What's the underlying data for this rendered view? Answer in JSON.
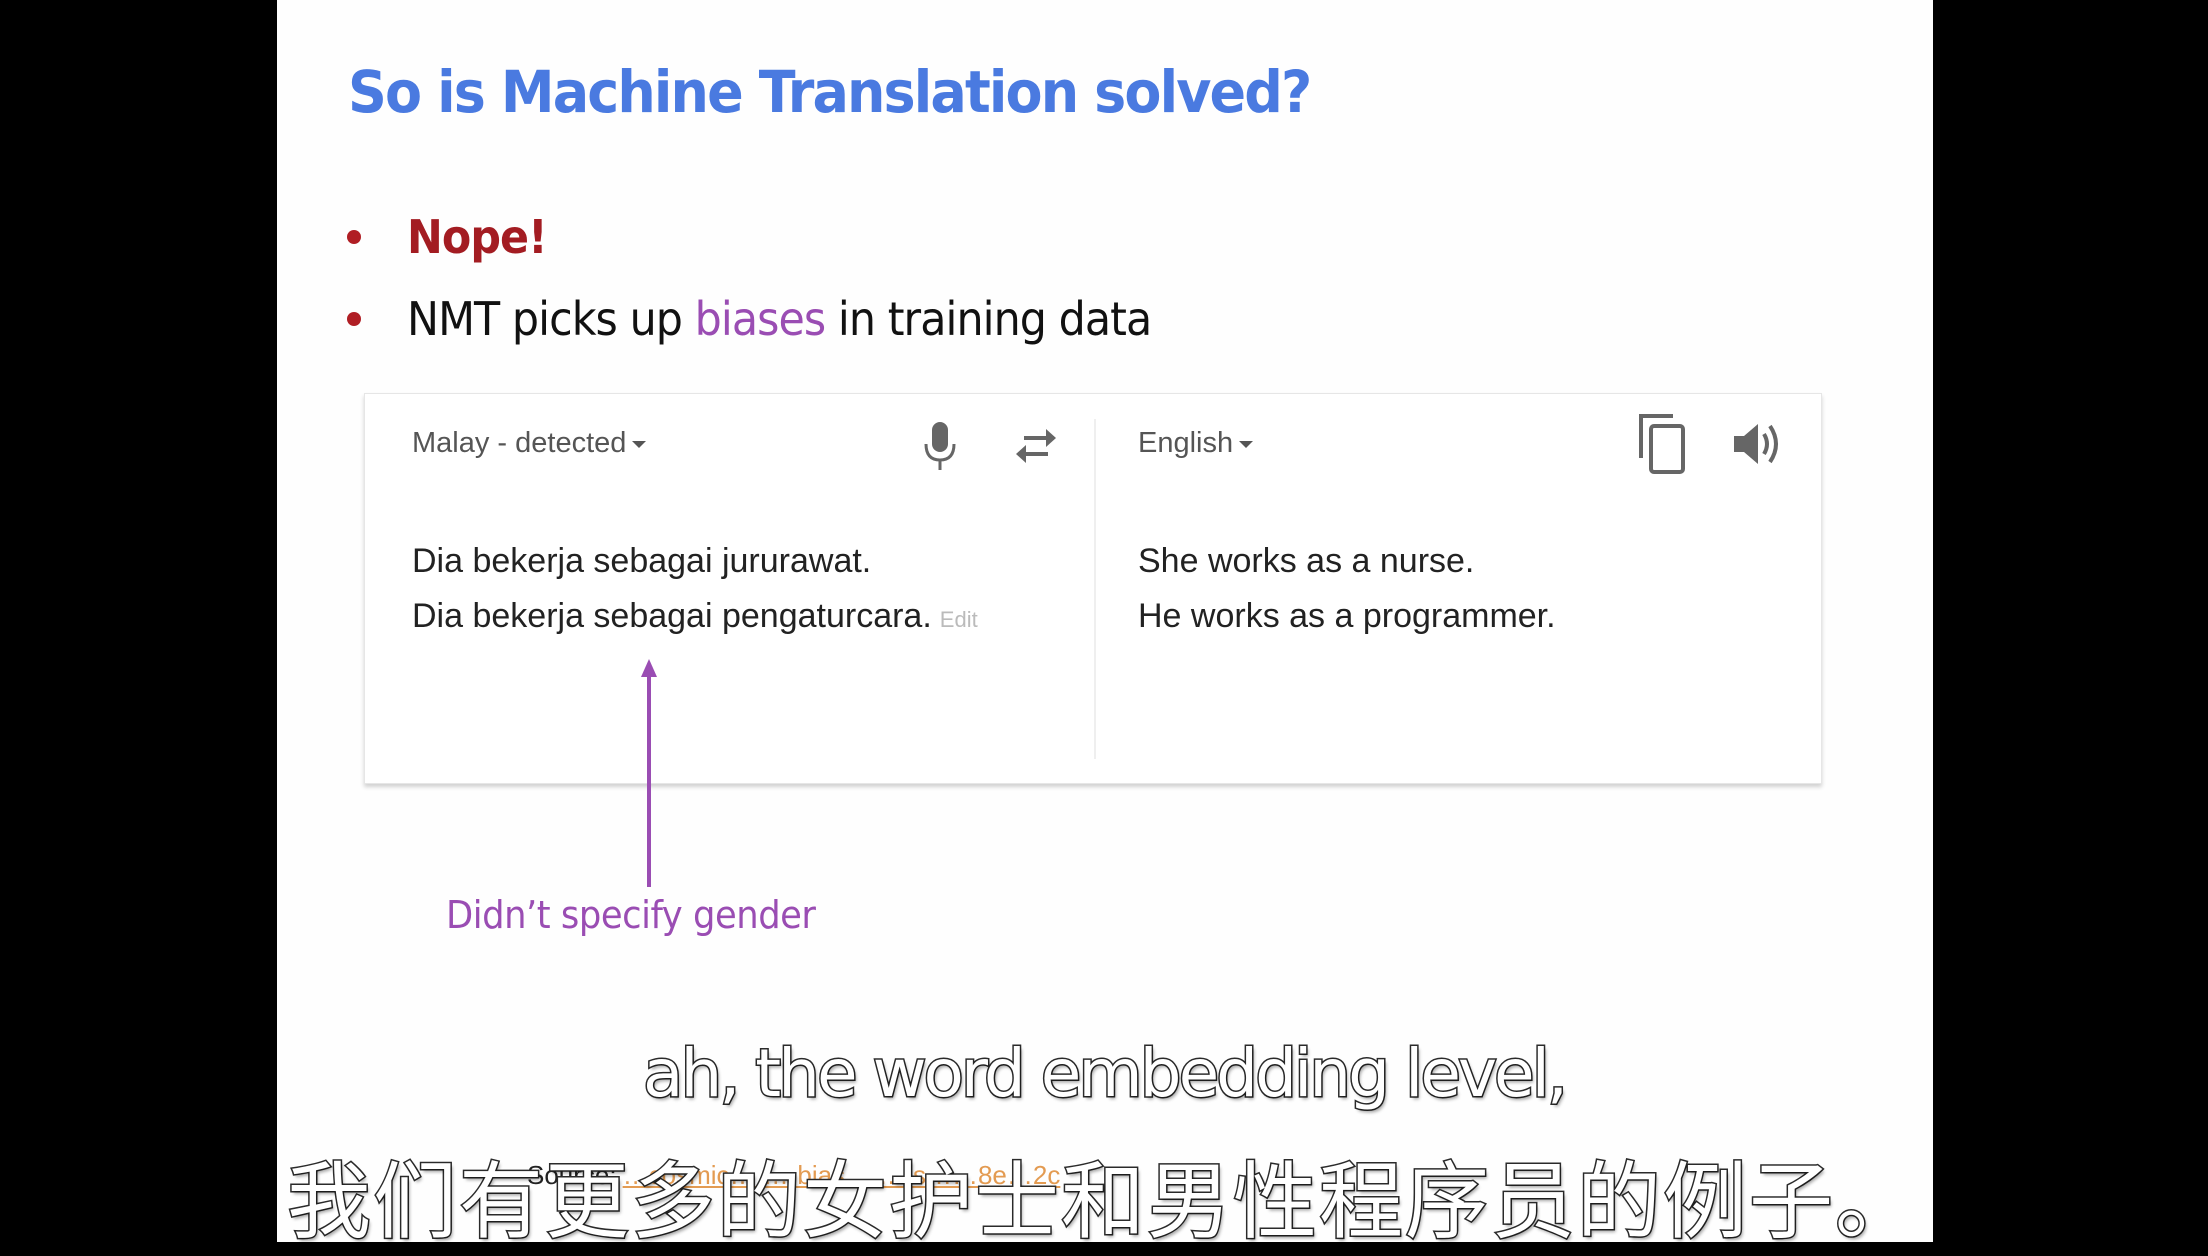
{
  "slide": {
    "title": "So is Machine Translation solved?",
    "bullets": [
      {
        "text": "Nope!"
      },
      {
        "before": "NMT picks up ",
        "highlight": "biases",
        "after": " in training data"
      }
    ],
    "annotation": "Didn’t specify gender",
    "source_label": "Source:",
    "source_link_partial": "…cosmic… …-bias… …-s……8e…2c"
  },
  "translator": {
    "source": {
      "language": "Malay - detected",
      "lines": [
        "Dia bekerja sebagai jururawat.",
        "Dia bekerja sebagai pengaturcara."
      ],
      "edit_label": "Edit",
      "icons": [
        "microphone-icon",
        "swap-languages-icon"
      ]
    },
    "target": {
      "language": "English",
      "lines": [
        "She works as a nurse.",
        "He works as a programmer."
      ],
      "icons": [
        "copy-icon",
        "speaker-icon"
      ]
    }
  },
  "subtitles": {
    "english": "ah, the word embedding level,",
    "chinese": "我们有更多的女护士和男性程序员的例子。"
  },
  "colors": {
    "title": "#4a7ae0",
    "nope": "#a31c22",
    "bullet_dot": "#b01e24",
    "highlight": "#9a4db3",
    "annotation": "#9a4db3"
  }
}
